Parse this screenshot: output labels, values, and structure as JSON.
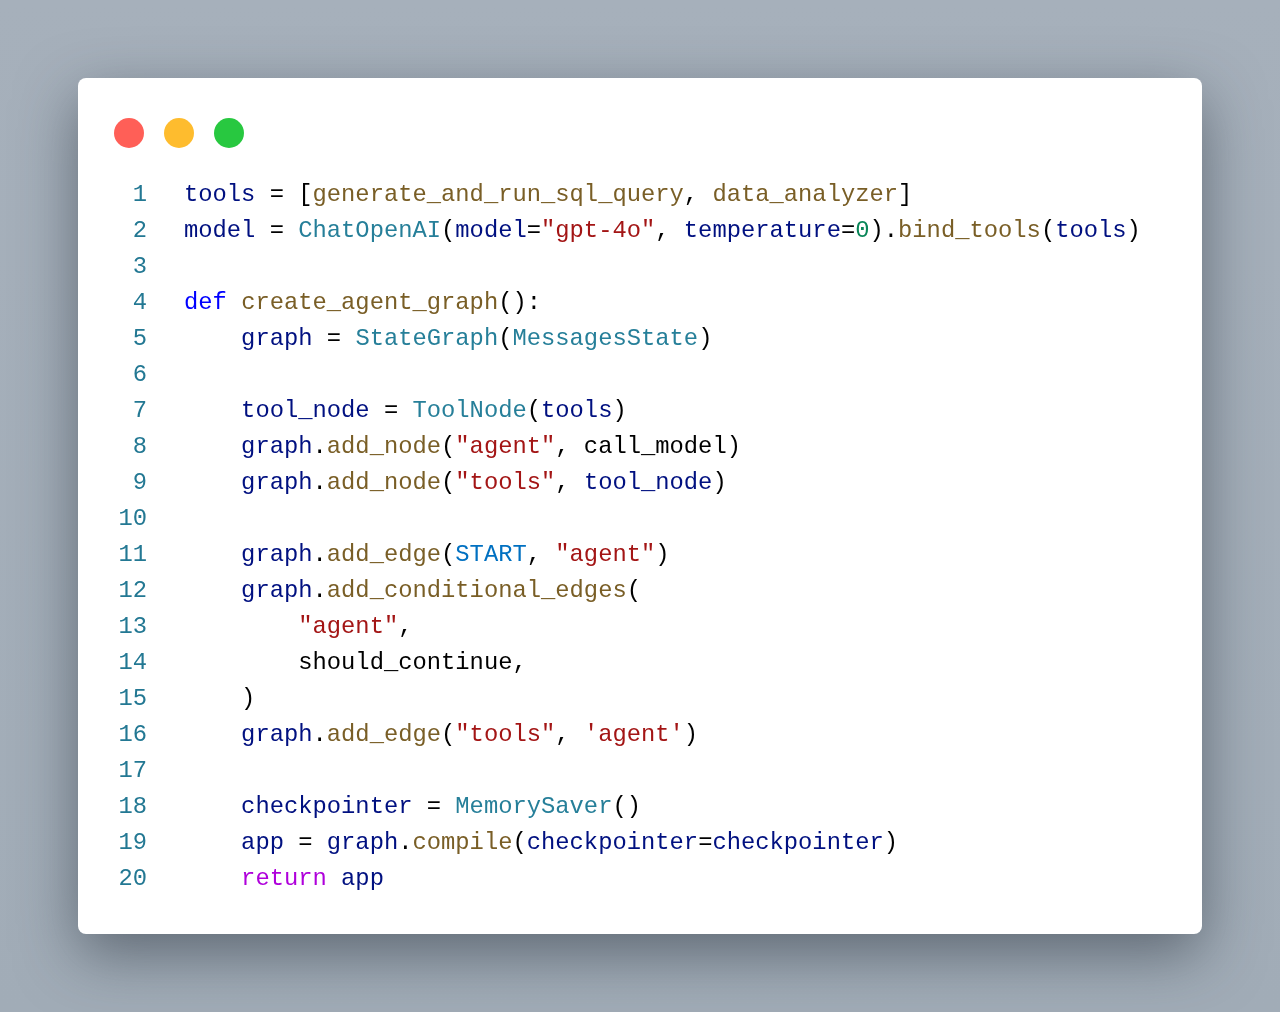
{
  "code_lines": [
    {
      "number": "1",
      "tokens": [
        {
          "kind": "var",
          "text": "tools"
        },
        {
          "kind": "plain",
          "text": " = ["
        },
        {
          "kind": "func",
          "text": "generate_and_run_sql_query"
        },
        {
          "kind": "plain",
          "text": ", "
        },
        {
          "kind": "func",
          "text": "data_analyzer"
        },
        {
          "kind": "plain",
          "text": "]"
        }
      ]
    },
    {
      "number": "2",
      "tokens": [
        {
          "kind": "var",
          "text": "model"
        },
        {
          "kind": "plain",
          "text": " = "
        },
        {
          "kind": "class",
          "text": "ChatOpenAI"
        },
        {
          "kind": "plain",
          "text": "("
        },
        {
          "kind": "var",
          "text": "model"
        },
        {
          "kind": "plain",
          "text": "="
        },
        {
          "kind": "string",
          "text": "\"gpt-4o\""
        },
        {
          "kind": "plain",
          "text": ", "
        },
        {
          "kind": "var",
          "text": "temperature"
        },
        {
          "kind": "plain",
          "text": "="
        },
        {
          "kind": "number",
          "text": "0"
        },
        {
          "kind": "plain",
          "text": ")."
        },
        {
          "kind": "func",
          "text": "bind_tools"
        },
        {
          "kind": "plain",
          "text": "("
        },
        {
          "kind": "var",
          "text": "tools"
        },
        {
          "kind": "plain",
          "text": ")"
        }
      ]
    },
    {
      "number": "3"
    },
    {
      "number": "4",
      "tokens": [
        {
          "kind": "keyword",
          "text": "def "
        },
        {
          "kind": "func",
          "text": "create_agent_graph"
        },
        {
          "kind": "plain",
          "text": "():"
        }
      ]
    },
    {
      "number": "5",
      "tokens": [
        {
          "kind": "var",
          "text": "    graph"
        },
        {
          "kind": "plain",
          "text": " = "
        },
        {
          "kind": "class",
          "text": "StateGraph"
        },
        {
          "kind": "plain",
          "text": "("
        },
        {
          "kind": "class",
          "text": "MessagesState"
        },
        {
          "kind": "plain",
          "text": ")"
        }
      ]
    },
    {
      "number": "6"
    },
    {
      "number": "7",
      "tokens": [
        {
          "kind": "var",
          "text": "    tool_node"
        },
        {
          "kind": "plain",
          "text": " = "
        },
        {
          "kind": "class",
          "text": "ToolNode"
        },
        {
          "kind": "plain",
          "text": "("
        },
        {
          "kind": "var",
          "text": "tools"
        },
        {
          "kind": "plain",
          "text": ")"
        }
      ]
    },
    {
      "number": "8",
      "tokens": [
        {
          "kind": "var",
          "text": "    graph"
        },
        {
          "kind": "plain",
          "text": "."
        },
        {
          "kind": "func",
          "text": "add_node"
        },
        {
          "kind": "plain",
          "text": "("
        },
        {
          "kind": "string",
          "text": "\"agent\""
        },
        {
          "kind": "plain",
          "text": ", call_model)"
        }
      ]
    },
    {
      "number": "9",
      "tokens": [
        {
          "kind": "var",
          "text": "    graph"
        },
        {
          "kind": "plain",
          "text": "."
        },
        {
          "kind": "func",
          "text": "add_node"
        },
        {
          "kind": "plain",
          "text": "("
        },
        {
          "kind": "string",
          "text": "\"tools\""
        },
        {
          "kind": "plain",
          "text": ", "
        },
        {
          "kind": "var",
          "text": "tool_node"
        },
        {
          "kind": "plain",
          "text": ")"
        }
      ]
    },
    {
      "number": "10"
    },
    {
      "number": "11",
      "tokens": [
        {
          "kind": "var",
          "text": "    graph"
        },
        {
          "kind": "plain",
          "text": "."
        },
        {
          "kind": "func",
          "text": "add_edge"
        },
        {
          "kind": "plain",
          "text": "("
        },
        {
          "kind": "const",
          "text": "START"
        },
        {
          "kind": "plain",
          "text": ", "
        },
        {
          "kind": "string",
          "text": "\"agent\""
        },
        {
          "kind": "plain",
          "text": ")"
        }
      ]
    },
    {
      "number": "12",
      "tokens": [
        {
          "kind": "var",
          "text": "    graph"
        },
        {
          "kind": "plain",
          "text": "."
        },
        {
          "kind": "func",
          "text": "add_conditional_edges"
        },
        {
          "kind": "plain",
          "text": "("
        }
      ]
    },
    {
      "number": "13",
      "tokens": [
        {
          "kind": "string",
          "text": "        \"agent\""
        },
        {
          "kind": "plain",
          "text": ","
        }
      ]
    },
    {
      "number": "14",
      "tokens": [
        {
          "kind": "plain",
          "text": "        should_continue,"
        }
      ]
    },
    {
      "number": "15",
      "tokens": [
        {
          "kind": "plain",
          "text": "    )"
        }
      ]
    },
    {
      "number": "16",
      "tokens": [
        {
          "kind": "var",
          "text": "    graph"
        },
        {
          "kind": "plain",
          "text": "."
        },
        {
          "kind": "func",
          "text": "add_edge"
        },
        {
          "kind": "plain",
          "text": "("
        },
        {
          "kind": "string",
          "text": "\"tools\""
        },
        {
          "kind": "plain",
          "text": ", "
        },
        {
          "kind": "string",
          "text": "'agent'"
        },
        {
          "kind": "plain",
          "text": ")"
        }
      ]
    },
    {
      "number": "17"
    },
    {
      "number": "18",
      "tokens": [
        {
          "kind": "var",
          "text": "    checkpointer"
        },
        {
          "kind": "plain",
          "text": " = "
        },
        {
          "kind": "class",
          "text": "MemorySaver"
        },
        {
          "kind": "plain",
          "text": "()"
        }
      ]
    },
    {
      "number": "19",
      "tokens": [
        {
          "kind": "var",
          "text": "    app"
        },
        {
          "kind": "plain",
          "text": " = "
        },
        {
          "kind": "var",
          "text": "graph"
        },
        {
          "kind": "plain",
          "text": "."
        },
        {
          "kind": "func",
          "text": "compile"
        },
        {
          "kind": "plain",
          "text": "("
        },
        {
          "kind": "var",
          "text": "checkpointer"
        },
        {
          "kind": "plain",
          "text": "="
        },
        {
          "kind": "var",
          "text": "checkpointer"
        },
        {
          "kind": "plain",
          "text": ")"
        }
      ]
    },
    {
      "number": "20",
      "tokens": [
        {
          "kind": "control",
          "text": "    return "
        },
        {
          "kind": "var",
          "text": "app"
        }
      ]
    }
  ]
}
